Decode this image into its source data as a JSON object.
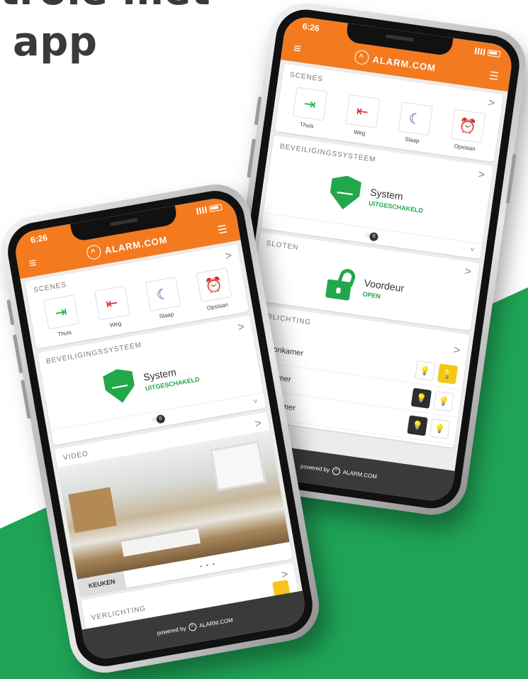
{
  "headline": {
    "line1": "trole met",
    "line2": "app"
  },
  "colors": {
    "brand": "#f47a20",
    "green": "#1fa356",
    "security_green": "#22a84a",
    "light_on": "#f5c518",
    "footer": "#3a3a3a"
  },
  "status_time": "6:26",
  "brand_name": "ALARM.COM",
  "icons": {
    "menu": "≡",
    "logo": "^",
    "toolbar_right": "☰",
    "chevron_right": ">",
    "chevron_down": "˅",
    "bulb": "💡",
    "lamp": "♁",
    "sensor": "◌",
    "shield_mark": "—"
  },
  "scenes": {
    "title": "SCENES",
    "items": [
      {
        "label": "Thuis",
        "glyph": "⇥",
        "color": "#22a84a"
      },
      {
        "label": "Weg",
        "glyph": "⇤",
        "color": "#e0252a"
      },
      {
        "label": "Slaap",
        "glyph": "☾",
        "color": "#6b3fa0"
      },
      {
        "label": "Opstaan",
        "glyph": "⏰",
        "color": "#e8b400"
      }
    ]
  },
  "security": {
    "title": "BEVEILIGINGSSYSTEEM",
    "name": "System",
    "state": "UITGESCHAKELD",
    "badge": "0"
  },
  "locks": {
    "title": "SLOTEN",
    "name": "Voordeur",
    "state": "OPEN"
  },
  "lighting": {
    "title": "VERLICHTING",
    "items": [
      {
        "name": "Woonkamer"
      },
      {
        "name": "Eetkamer"
      },
      {
        "name": "Slaapkamer"
      }
    ]
  },
  "video": {
    "title": "VIDEO",
    "camera": "KEUKEN",
    "dots": "• • •"
  },
  "footer": {
    "powered_by": "powered by",
    "brand": "ALARM.COM"
  }
}
